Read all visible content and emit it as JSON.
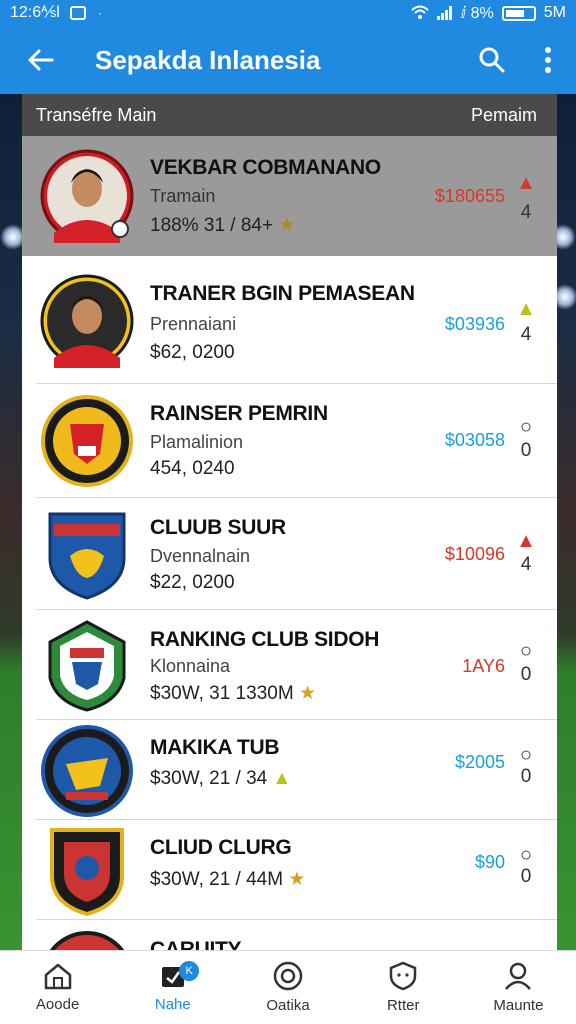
{
  "status_bar": {
    "time": "12:6⅍l",
    "dot": "·",
    "right_text": "ⅈ 8%",
    "right_signal": "5M"
  },
  "app_bar": {
    "title": "Sepakda Inlanesia"
  },
  "panel_header": {
    "left": "Transéfre Main",
    "right": "Pemaim"
  },
  "rows": [
    {
      "name": "VEKBAR COBMANANO",
      "sub": "Tramain",
      "val": "188% 31 / 84+",
      "price": "$180655",
      "price_color": "#d23a2a",
      "rank": "4",
      "rank_icon": "flame",
      "val_star": "★"
    },
    {
      "name": "TRANER BGIN PEMASEAN",
      "sub": "Prennaiani",
      "val": "$62, 0200",
      "price": "$03936",
      "price_color": "#1aa0d8",
      "rank": "4",
      "rank_icon": "up-arrow"
    },
    {
      "name": "RAINSER PEMRIN",
      "sub": "Plamalinion",
      "val": "454, 0240",
      "price": "$03058",
      "price_color": "#1aa0d8",
      "rank": "0",
      "rank_icon": "circle"
    },
    {
      "name": "CLUUB SUUR",
      "sub": "Dvennalnain",
      "val": "$22, 0200",
      "price": "$10096",
      "price_color": "#d23a2a",
      "rank": "4",
      "rank_icon": "flame"
    },
    {
      "name": "RANKING CLUB SIDOH",
      "sub": "Klonnaina",
      "val": "$30W, 31 1330M",
      "price": "1AY6",
      "price_color": "#d23a2a",
      "rank": "0",
      "rank_icon": "circle",
      "val_star": "★"
    },
    {
      "name": "MAKIKA TUB",
      "sub": "",
      "val": "$30W, 21 / 34",
      "price": "$2005",
      "price_color": "#1aa0d8",
      "rank": "0",
      "rank_icon": "circle",
      "val_star": "▲"
    },
    {
      "name": "CLIUD CLURG",
      "sub": "",
      "val": "$30W, 21 / 44M",
      "price": "$90",
      "price_color": "#1aa0d8",
      "rank": "0",
      "rank_icon": "circle",
      "val_star": "★"
    },
    {
      "name": "CARUITY",
      "sub": "",
      "val": "",
      "price": "",
      "price_color": "#1aa0d8",
      "rank": "",
      "rank_icon": ""
    }
  ],
  "bottom_nav": [
    {
      "label": "Aoode",
      "icon": "home-icon"
    },
    {
      "label": "Nahe",
      "icon": "tag-icon",
      "badge": "K"
    },
    {
      "label": "Oatika",
      "icon": "target-icon"
    },
    {
      "label": "Rtter",
      "icon": "shield-icon"
    },
    {
      "label": "Maunte",
      "icon": "person-icon"
    }
  ]
}
